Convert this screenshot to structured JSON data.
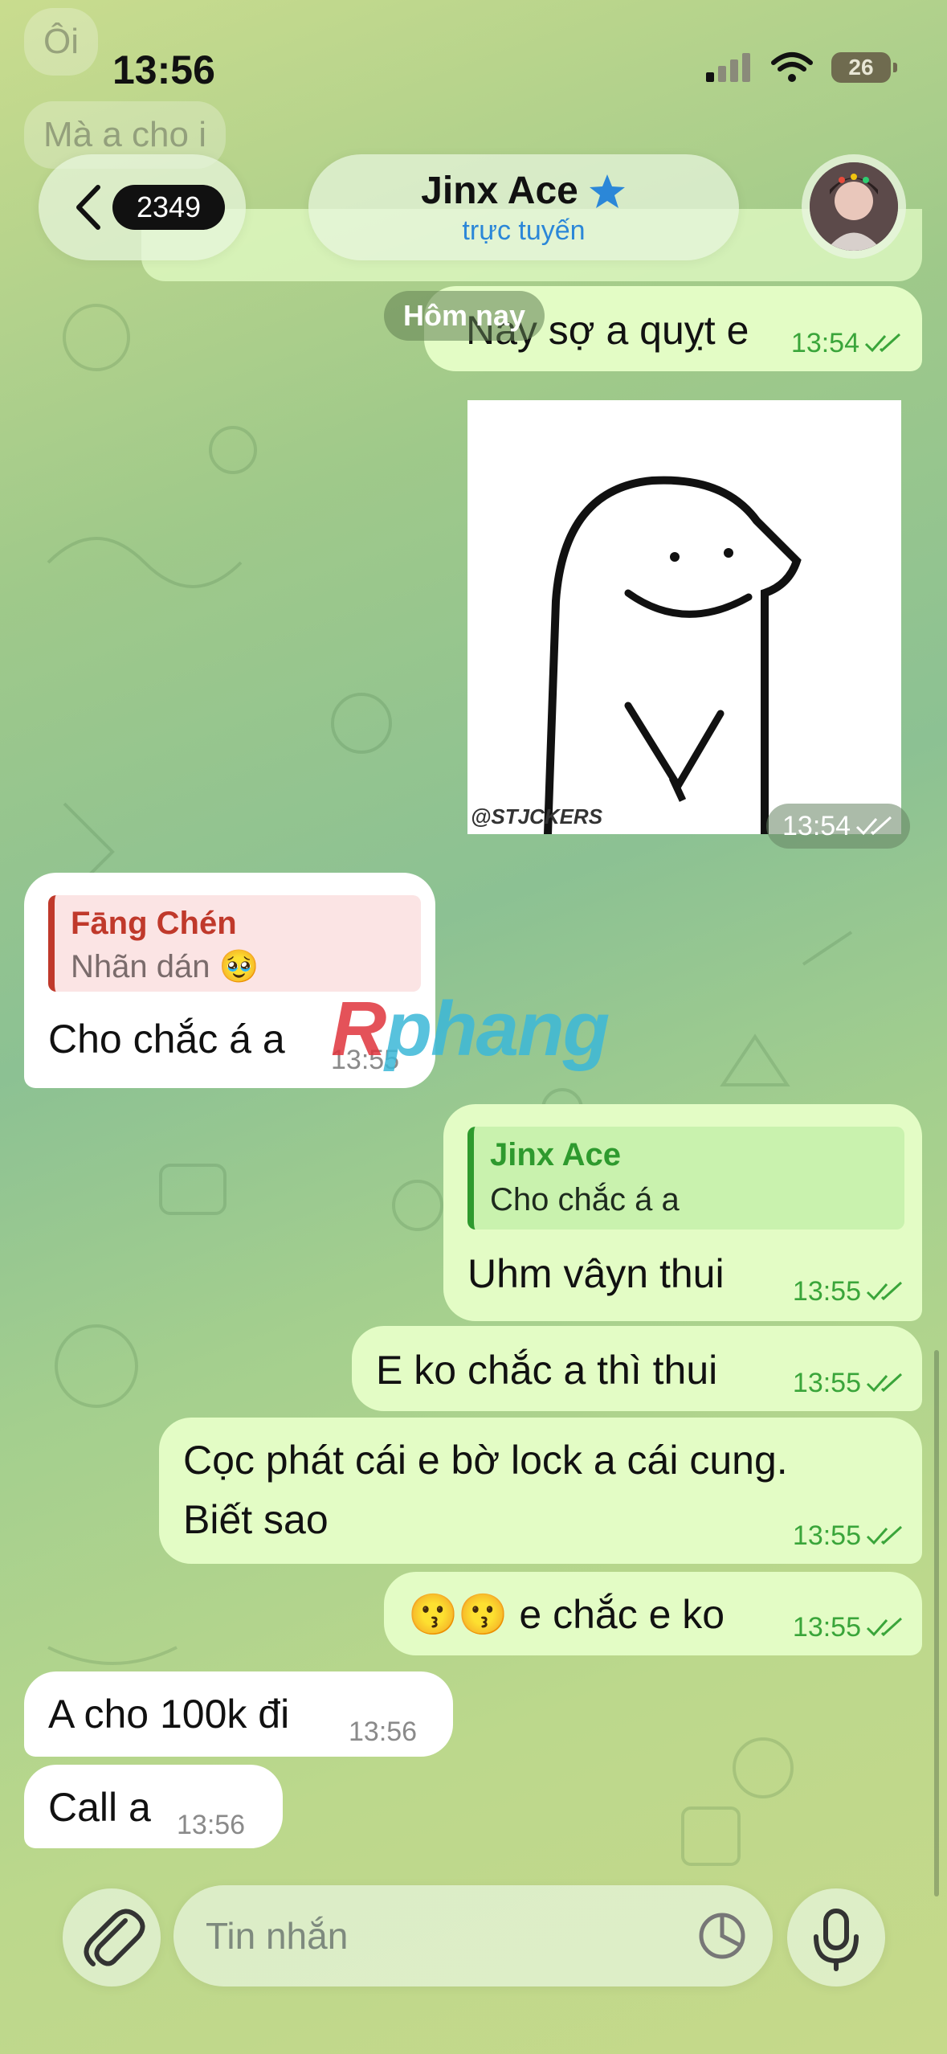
{
  "status_bar": {
    "time": "13:56",
    "battery": "26"
  },
  "header": {
    "back_count": "2349",
    "contact_name": "Jinx Ace",
    "contact_status": "trực tuyến"
  },
  "date_chip": "Hôm nay",
  "ghost_texts": {
    "top1": "Ôi",
    "top2": "Mà a cho i",
    "top3": "Nay sợ a quỵt e",
    "top3_time": "13:54"
  },
  "sticker": {
    "watermark": "@STJCKERS",
    "time": "13:54"
  },
  "messages": [
    {
      "dir": "in",
      "reply_name": "Fāng Chén",
      "reply_text": "Nhãn dán 🥹",
      "text": "Cho chắc á a",
      "time": "13:55"
    },
    {
      "dir": "out",
      "reply_name": "Jinx Ace",
      "reply_text": "Cho chắc á a",
      "text": "Uhm vâyn thui",
      "time": "13:55"
    },
    {
      "dir": "out",
      "text": "E ko chắc a thì thui",
      "time": "13:55"
    },
    {
      "dir": "out",
      "text_line1": "Cọc phát cái e bờ lock a cái cung.",
      "text_line2": "Biết sao",
      "time": "13:55"
    },
    {
      "dir": "out",
      "text": "😗😗 e chắc e ko",
      "time": "13:55"
    },
    {
      "dir": "in",
      "text": "A cho 100k đi",
      "time": "13:56"
    },
    {
      "dir": "in",
      "text": "Call a",
      "time": "13:56"
    }
  ],
  "watermark_brand": {
    "first": "R",
    "rest": "phang"
  },
  "input": {
    "placeholder": "Tin nhắn"
  },
  "colors": {
    "out_bubble": "#e3fcc5",
    "in_bubble": "#ffffff",
    "accent_blue": "#2b87d8",
    "reply_red": "#c0392b",
    "reply_green": "#2e9a2e"
  }
}
